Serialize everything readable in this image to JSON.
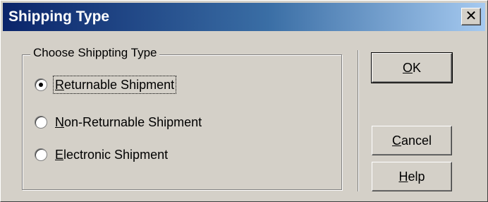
{
  "dialog": {
    "title": "Shipping Type",
    "close_glyph": "✕"
  },
  "group": {
    "label": "Choose Shippting Type",
    "options": [
      {
        "mnemonic": "R",
        "rest": "eturnable Shipment",
        "checked": true
      },
      {
        "mnemonic": "N",
        "rest": "on-Returnable Shipment",
        "checked": false
      },
      {
        "mnemonic": "E",
        "rest": "lectronic Shipment",
        "checked": false
      }
    ]
  },
  "buttons": {
    "ok": {
      "mnemonic": "O",
      "rest": "K"
    },
    "cancel": {
      "mnemonic": "C",
      "rest": "ancel"
    },
    "help": {
      "mnemonic": "H",
      "rest": "elp"
    }
  },
  "icons": {
    "close": "close-icon",
    "radio": "radio-icon"
  }
}
